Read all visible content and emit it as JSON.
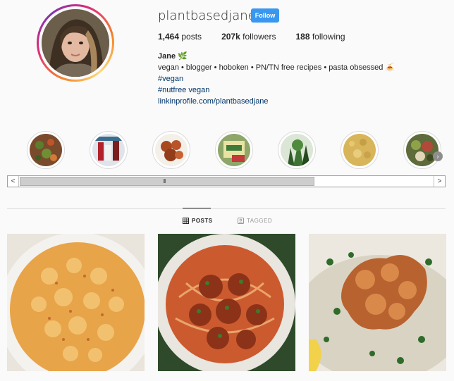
{
  "profile": {
    "username": "plantbasedjane",
    "follow_label": "Follow",
    "stats": {
      "posts_count": "1,464",
      "posts_label": "posts",
      "followers_count": "207k",
      "followers_label": "followers",
      "following_count": "188",
      "following_label": "following"
    },
    "bio": {
      "name": "Jane 🌿",
      "line1": "vegan • blogger • hoboken • PN/TN free recipes • pasta obsessed 🍝",
      "hashtag1": "#vegan",
      "hashtag2": "#nutfree vegan",
      "link": "linkinprofile.com/plantbasedjane"
    }
  },
  "highlights": [
    {
      "name": "highlight-salad"
    },
    {
      "name": "highlight-sauces"
    },
    {
      "name": "highlight-cauliflower"
    },
    {
      "name": "highlight-product"
    },
    {
      "name": "highlight-plants"
    },
    {
      "name": "highlight-rice"
    },
    {
      "name": "highlight-bowl"
    }
  ],
  "tabs": {
    "posts_label": "POSTS",
    "tagged_label": "TAGGED"
  },
  "scrollbar": {
    "left_arrow": "<",
    "right_arrow": ">",
    "grip": "III"
  },
  "colors": {
    "follow_blue": "#3897f0",
    "link_blue": "#003569",
    "background": "#fafafa"
  }
}
